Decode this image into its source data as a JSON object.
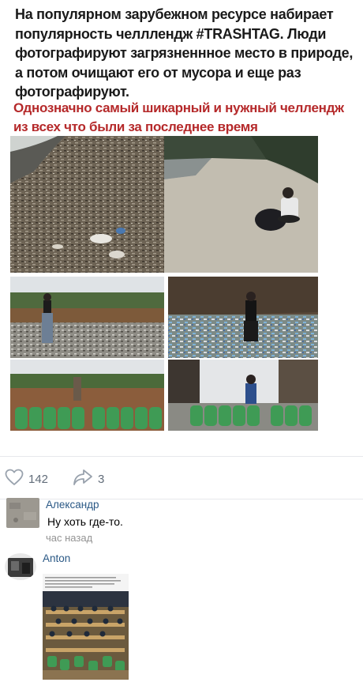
{
  "post": {
    "caption_main": "На популярном зарубежном ресурсе набирает\nпопулярность челллендж #TRASHTAG. Люди\nфотографируют загрязненнное  место в природе,\nа потом очищают его от мусора и еще раз\nфотографируют.",
    "caption_highlight": "Однозначно самый шикарный и нужный челлендж\nиз всех что были за последнее время",
    "highlight_color": "#b5292a",
    "photos": [
      {
        "name": "photo-beach-before",
        "scene": "beach covered with trash"
      },
      {
        "name": "photo-beach-after",
        "scene": "clean beach with person and trash bags"
      },
      {
        "name": "photo-field-before",
        "scene": "man standing in littered field"
      },
      {
        "name": "photo-riverbank-before",
        "scene": "man sitting on trash-covered riverbank"
      },
      {
        "name": "photo-field-after",
        "scene": "cleaned field with green trash bags"
      },
      {
        "name": "photo-riverbank-after",
        "scene": "person with green trash bags"
      }
    ]
  },
  "actions": {
    "likes_count": "142",
    "shares_count": "3",
    "like_icon": "heart-icon",
    "share_icon": "share-arrow-icon"
  },
  "comments": [
    {
      "author": "Александр",
      "text": "Ну хоть где-то.",
      "time": "час назад"
    },
    {
      "author": "Anton",
      "attachment": "screenshot of auditorium with green trash bags"
    }
  ],
  "colors": {
    "link": "#2a5885",
    "meta": "#939393",
    "icon": "#99a2ad",
    "bag_green": "#3f9b55"
  }
}
